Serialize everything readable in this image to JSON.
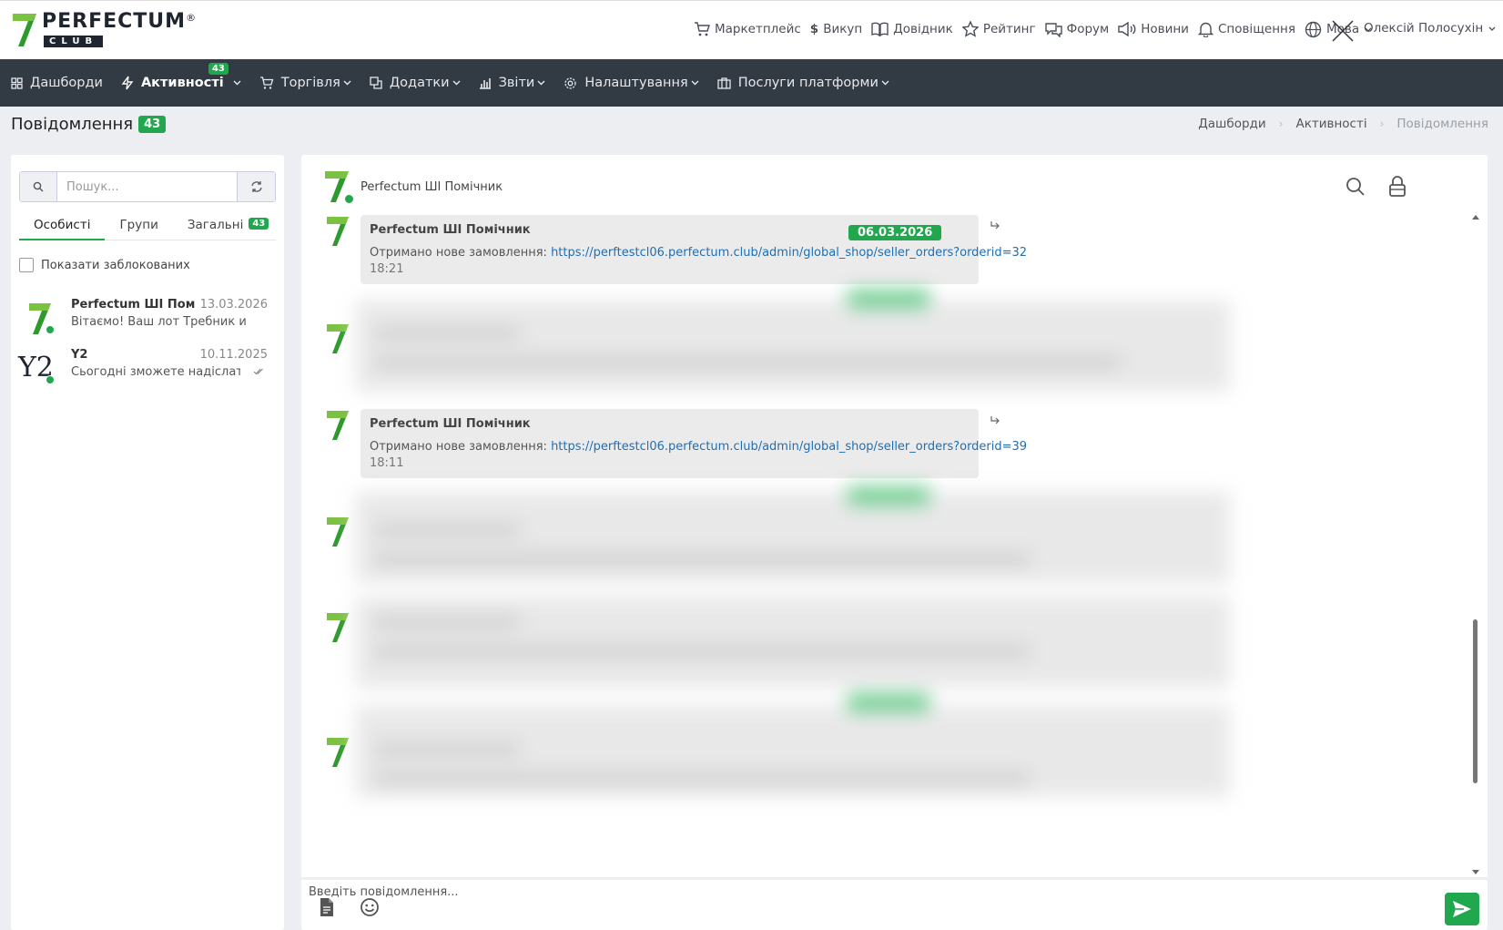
{
  "logo": {
    "word": "PERFECTUM",
    "reg": "®",
    "club": "CLUB"
  },
  "topnav": {
    "items": [
      {
        "label": "Маркетплейс",
        "icon": "cart-icon"
      },
      {
        "label": "Викуп",
        "icon": "dollar-icon"
      },
      {
        "label": "Довідник",
        "icon": "book-icon"
      },
      {
        "label": "Рейтинг",
        "icon": "star-icon"
      },
      {
        "label": "Форум",
        "icon": "chat-icon"
      },
      {
        "label": "Новини",
        "icon": "megaphone-icon"
      },
      {
        "label": "Сповіщення",
        "icon": "bell-icon"
      },
      {
        "label": "Мова",
        "icon": "globe-icon"
      }
    ],
    "user_name": "Олексій Полосухін"
  },
  "mainnav": {
    "items": [
      {
        "label": "Дашборди"
      },
      {
        "label": "Активності",
        "badge": "43"
      },
      {
        "label": "Торгівля"
      },
      {
        "label": "Додатки"
      },
      {
        "label": "Звіти"
      },
      {
        "label": "Налаштування"
      },
      {
        "label": "Послуги платформи"
      }
    ]
  },
  "page": {
    "title": "Повідомлення",
    "badge": "43",
    "breadcrumb": [
      "Дашборди",
      "Активності",
      "Повідомлення"
    ]
  },
  "sidebar": {
    "search_placeholder": "Пошук...",
    "tabs": [
      {
        "label": "Особисті"
      },
      {
        "label": "Групи"
      },
      {
        "label": "Загальні",
        "badge": "43"
      }
    ],
    "show_blocked_label": "Показати заблокованих",
    "contacts": [
      {
        "name": "Perfectum ШІ Помічник",
        "date": "13.03.2026",
        "preview": "Вітаємо! Ваш лот Требник или Молитвослов"
      },
      {
        "name": "Y2",
        "avatar_text": "Y2",
        "date": "10.11.2025",
        "preview": "Сьогодні зможете надіслати за"
      }
    ]
  },
  "chat": {
    "header_name": "Perfectum ШІ Помічник",
    "messages": [
      {
        "sender": "Perfectum ШІ Помічник",
        "date": "06.03.2026",
        "text": "Отримано нове замовлення: ",
        "link": "https://perftestcl06.perfectum.club/admin/global_shop/seller_orders?orderid=32",
        "time": "18:21"
      },
      {
        "sender": "Perfectum ШІ Помічник",
        "text": "Отримано нове замовлення: ",
        "link": "https://perftestcl06.perfectum.club/admin/global_shop/seller_orders?orderid=39",
        "time": "18:11"
      }
    ],
    "composer_placeholder": "Введіть повідомлення..."
  },
  "colors": {
    "accent": "#21a84e",
    "nav_bg": "#323a44",
    "link": "#1e6fb4"
  }
}
